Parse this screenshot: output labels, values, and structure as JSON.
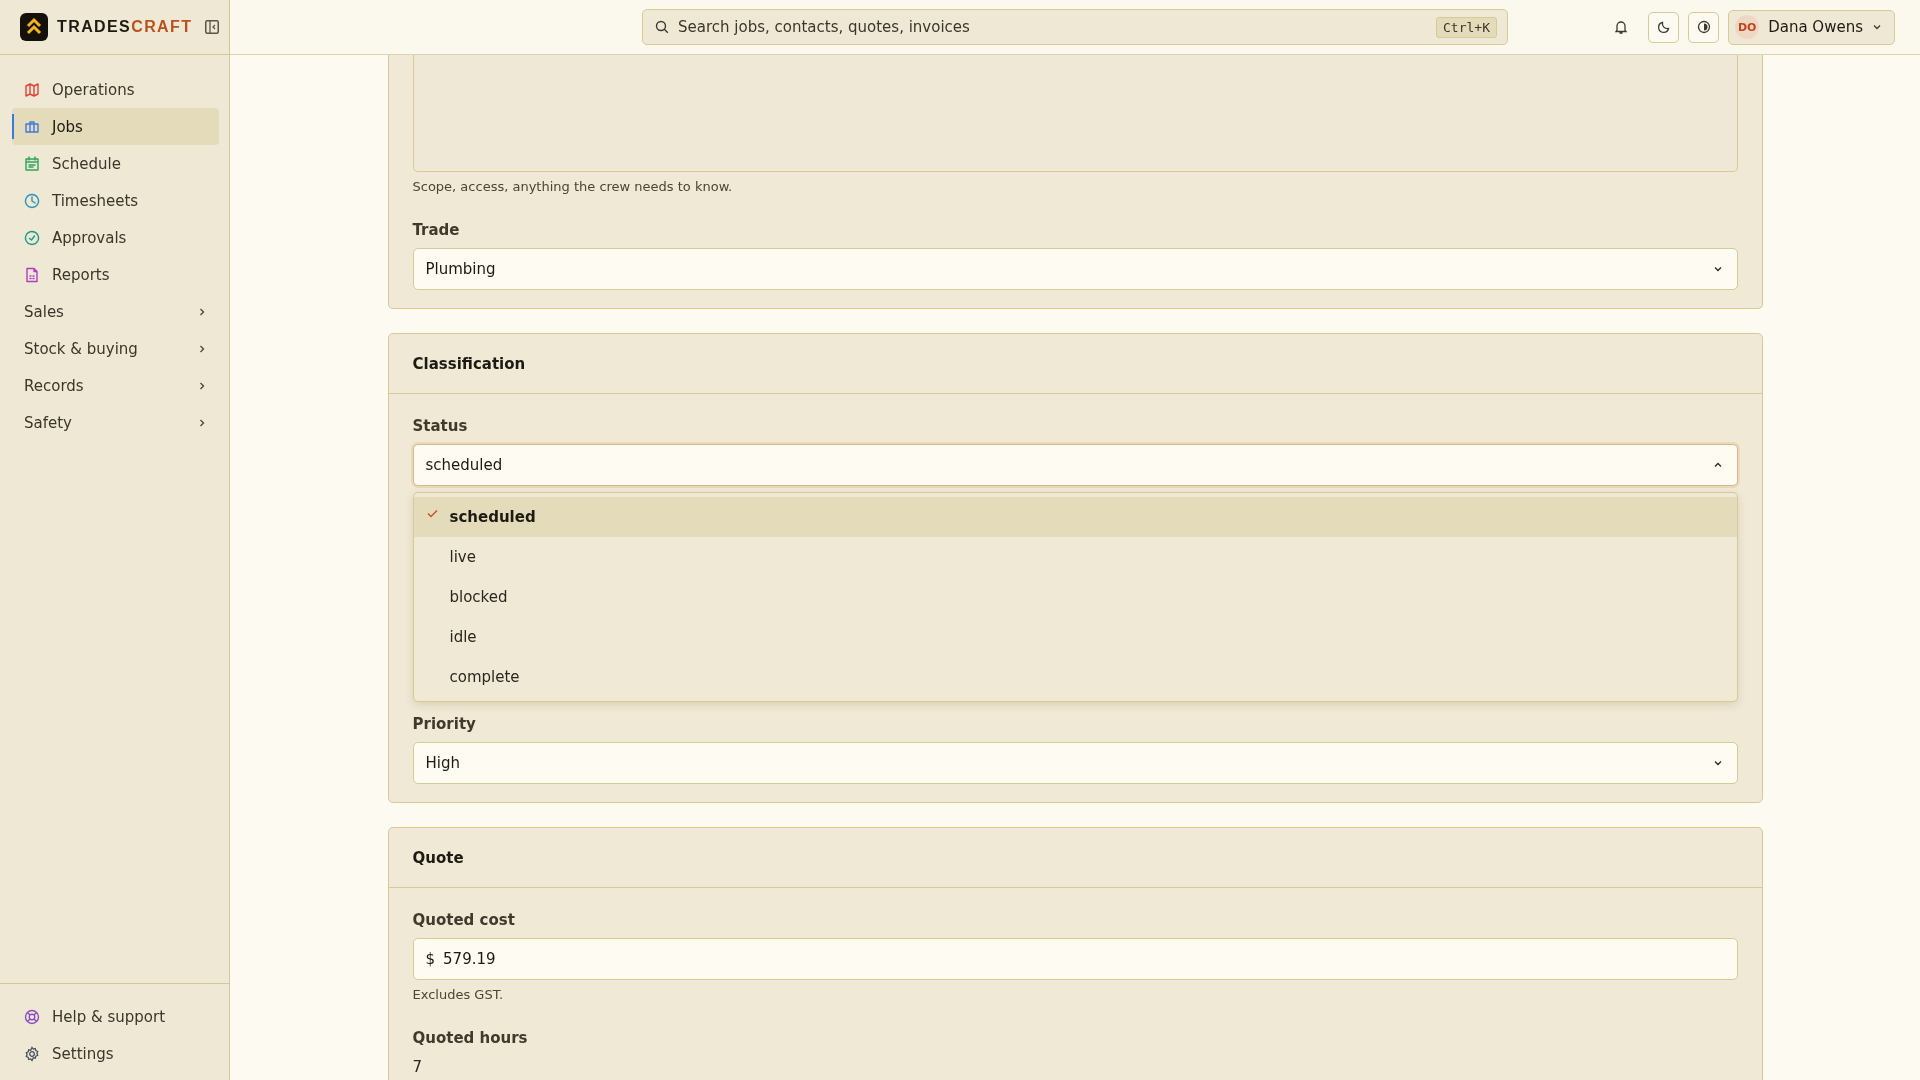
{
  "brand": {
    "primary": "TRADES",
    "accent": "CRAFT"
  },
  "sidebar": {
    "items": [
      {
        "label": "Operations",
        "kind": "link",
        "selected": false
      },
      {
        "label": "Jobs",
        "kind": "link",
        "selected": true
      },
      {
        "label": "Schedule",
        "kind": "link",
        "selected": false
      },
      {
        "label": "Timesheets",
        "kind": "link",
        "selected": false
      },
      {
        "label": "Approvals",
        "kind": "link",
        "selected": false
      },
      {
        "label": "Reports",
        "kind": "link",
        "selected": false
      },
      {
        "label": "Sales",
        "kind": "group",
        "expanded": false
      },
      {
        "label": "Stock & buying",
        "kind": "group",
        "expanded": false
      },
      {
        "label": "Records",
        "kind": "group",
        "expanded": false
      },
      {
        "label": "Safety",
        "kind": "group",
        "expanded": false
      }
    ],
    "footer_items": [
      {
        "label": "Help & support"
      },
      {
        "label": "Settings"
      }
    ]
  },
  "topbar": {
    "search": {
      "placeholder": "Search jobs, contacts, quotes, invoices",
      "shortcut": "Ctrl+K"
    },
    "user": {
      "initials": "DO",
      "name": "Dana Owens"
    }
  },
  "sections": [
    {
      "fields": [
        {
          "kind": "textarea",
          "hint": "Scope, access, anything the crew needs to know."
        },
        {
          "kind": "select",
          "label": "Trade",
          "value": "Plumbing",
          "expanded": false
        }
      ]
    },
    {
      "title": "Classification",
      "fields": [
        {
          "kind": "select",
          "label": "Status",
          "value": "scheduled",
          "expanded": true,
          "options": [
            {
              "label": "scheduled",
              "selected": true
            },
            {
              "label": "live",
              "selected": false
            },
            {
              "label": "blocked",
              "selected": false
            },
            {
              "label": "idle",
              "selected": false
            },
            {
              "label": "complete",
              "selected": false
            }
          ]
        },
        {
          "kind": "select",
          "label": "Priority",
          "value": "High",
          "expanded": false
        }
      ]
    },
    {
      "title": "Quote",
      "fields": [
        {
          "kind": "money",
          "label": "Quoted cost",
          "prefix": "$",
          "value": "579.19",
          "hint": "Excludes GST."
        },
        {
          "kind": "plain",
          "label": "Quoted hours",
          "value": "7"
        }
      ]
    }
  ]
}
